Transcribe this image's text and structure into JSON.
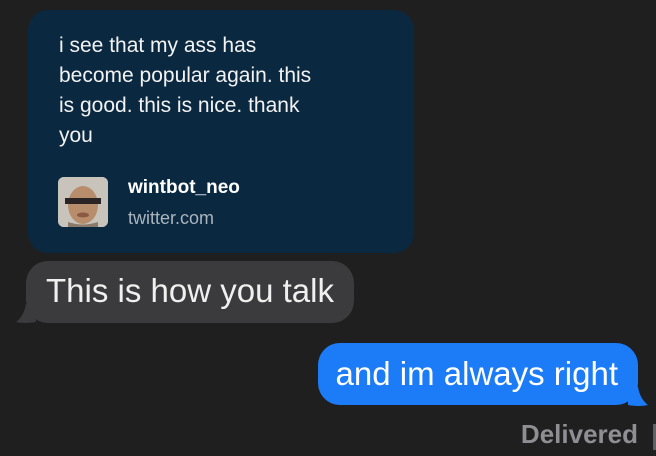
{
  "conversation": {
    "link_preview": {
      "text": "i see that my ass has\nbecome popular again. this\nis good. this is nice. thank\nyou",
      "user": "wintbot_neo",
      "domain": "twitter.com",
      "avatar_icon": "profile-photo"
    },
    "messages": [
      {
        "direction": "incoming",
        "text": "This is how you talk"
      },
      {
        "direction": "outgoing",
        "text": "and im always right"
      }
    ],
    "status": "Delivered"
  },
  "colors": {
    "background": "#1f1f1f",
    "link_card": "#0a2940",
    "incoming_bubble": "#3b3b3d",
    "outgoing_bubble": "#1c7cf7",
    "status_text": "#8e8e93"
  }
}
